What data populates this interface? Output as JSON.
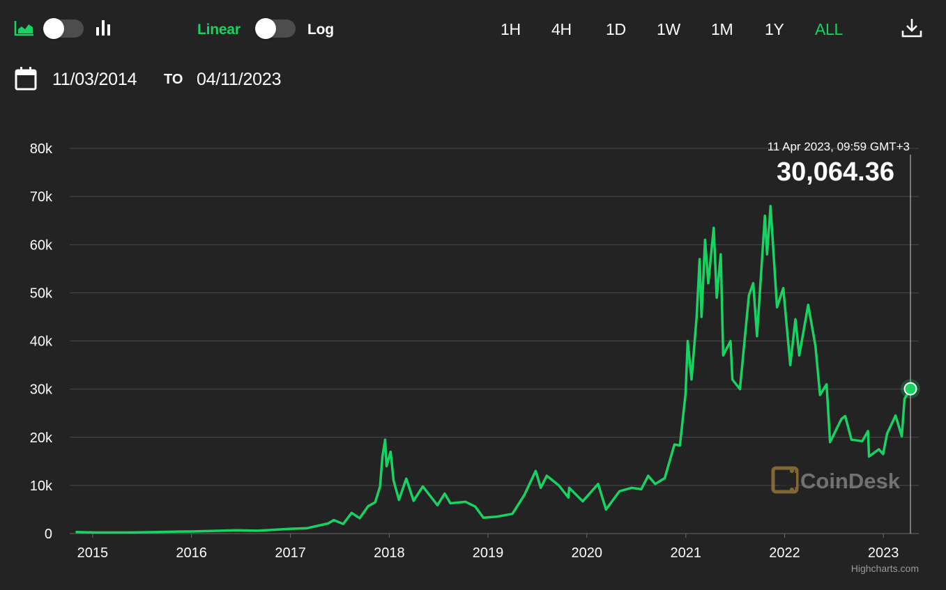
{
  "toolbar": {
    "chart_type_toggle": {
      "left_icon": "area-chart-icon",
      "right_icon": "bar-chart-icon",
      "on": false
    },
    "scale": {
      "linear_label": "Linear",
      "log_label": "Log",
      "log_on": false
    },
    "ranges": [
      "1H",
      "4H",
      "1D",
      "1W",
      "1M",
      "1Y",
      "ALL"
    ],
    "active_range": "ALL",
    "download_icon": "download-icon"
  },
  "date_range": {
    "calendar_icon": "calendar-icon",
    "from": "11/03/2014",
    "to_label": "TO",
    "to": "04/11/2023"
  },
  "tooltip": {
    "date": "11 Apr 2023, 09:59 GMT+3",
    "value": "30,064.36"
  },
  "watermark": "CoinDesk",
  "credits": "Highcharts.com",
  "colors": {
    "accent": "#17d462",
    "background": "#232323",
    "grid": "#4a4a4a",
    "toggle_track": "#4d4d4d"
  },
  "chart_data": {
    "type": "line",
    "x_label": "",
    "y_label": "",
    "y_range": [
      0,
      80000
    ],
    "y_ticks": [
      0,
      10000,
      20000,
      30000,
      40000,
      50000,
      60000,
      70000,
      80000
    ],
    "y_tick_labels": [
      "0",
      "10k",
      "20k",
      "30k",
      "40k",
      "50k",
      "60k",
      "70k",
      "80k"
    ],
    "x_ticks": [
      "2015",
      "2016",
      "2017",
      "2018",
      "2019",
      "2020",
      "2021",
      "2022",
      "2023"
    ],
    "x_range": [
      "2014-11-03",
      "2023-04-11"
    ],
    "grid": true,
    "series": [
      {
        "values_note_free": true,
        "points": [
          [
            "2014-11-03",
            330
          ],
          [
            "2015-01-15",
            210
          ],
          [
            "2015-06-01",
            230
          ],
          [
            "2015-11-05",
            400
          ],
          [
            "2016-01-01",
            430
          ],
          [
            "2016-06-15",
            700
          ],
          [
            "2016-09-01",
            600
          ],
          [
            "2017-01-01",
            1000
          ],
          [
            "2017-03-01",
            1100
          ],
          [
            "2017-05-20",
            2100
          ],
          [
            "2017-06-10",
            2800
          ],
          [
            "2017-07-15",
            2000
          ],
          [
            "2017-08-15",
            4300
          ],
          [
            "2017-09-14",
            3200
          ],
          [
            "2017-10-15",
            5700
          ],
          [
            "2017-11-10",
            6500
          ],
          [
            "2017-11-28",
            9800
          ],
          [
            "2017-12-07",
            16000
          ],
          [
            "2017-12-17",
            19500
          ],
          [
            "2017-12-22",
            14000
          ],
          [
            "2018-01-06",
            17000
          ],
          [
            "2018-01-17",
            11000
          ],
          [
            "2018-02-06",
            7000
          ],
          [
            "2018-03-05",
            11400
          ],
          [
            "2018-04-01",
            6800
          ],
          [
            "2018-05-05",
            9800
          ],
          [
            "2018-06-28",
            5900
          ],
          [
            "2018-07-25",
            8300
          ],
          [
            "2018-08-15",
            6300
          ],
          [
            "2018-10-10",
            6600
          ],
          [
            "2018-11-15",
            5600
          ],
          [
            "2018-12-15",
            3300
          ],
          [
            "2019-02-01",
            3500
          ],
          [
            "2019-04-01",
            4100
          ],
          [
            "2019-05-15",
            8000
          ],
          [
            "2019-06-26",
            13000
          ],
          [
            "2019-07-15",
            9500
          ],
          [
            "2019-08-06",
            12000
          ],
          [
            "2019-09-20",
            10000
          ],
          [
            "2019-10-25",
            7500
          ],
          [
            "2019-10-28",
            9500
          ],
          [
            "2019-12-17",
            6700
          ],
          [
            "2020-02-12",
            10300
          ],
          [
            "2020-03-12",
            5000
          ],
          [
            "2020-05-01",
            8800
          ],
          [
            "2020-06-15",
            9500
          ],
          [
            "2020-07-20",
            9200
          ],
          [
            "2020-08-15",
            12000
          ],
          [
            "2020-09-10",
            10300
          ],
          [
            "2020-10-15",
            11500
          ],
          [
            "2020-11-20",
            18500
          ],
          [
            "2020-12-10",
            18300
          ],
          [
            "2020-12-31",
            29000
          ],
          [
            "2021-01-08",
            40000
          ],
          [
            "2021-01-22",
            32000
          ],
          [
            "2021-02-10",
            45000
          ],
          [
            "2021-02-21",
            57000
          ],
          [
            "2021-02-28",
            45000
          ],
          [
            "2021-03-13",
            61000
          ],
          [
            "2021-03-25",
            52000
          ],
          [
            "2021-04-14",
            63500
          ],
          [
            "2021-04-25",
            49000
          ],
          [
            "2021-05-10",
            58000
          ],
          [
            "2021-05-19",
            37000
          ],
          [
            "2021-06-15",
            40000
          ],
          [
            "2021-06-22",
            32000
          ],
          [
            "2021-07-20",
            30000
          ],
          [
            "2021-08-22",
            49500
          ],
          [
            "2021-09-07",
            52000
          ],
          [
            "2021-09-21",
            41000
          ],
          [
            "2021-10-20",
            66000
          ],
          [
            "2021-10-28",
            58000
          ],
          [
            "2021-11-10",
            68000
          ],
          [
            "2021-12-04",
            47000
          ],
          [
            "2021-12-27",
            51000
          ],
          [
            "2022-01-22",
            35000
          ],
          [
            "2022-02-10",
            44500
          ],
          [
            "2022-02-24",
            37000
          ],
          [
            "2022-03-29",
            47500
          ],
          [
            "2022-04-25",
            39000
          ],
          [
            "2022-05-12",
            28800
          ],
          [
            "2022-06-05",
            31000
          ],
          [
            "2022-06-18",
            19000
          ],
          [
            "2022-07-30",
            23800
          ],
          [
            "2022-08-13",
            24400
          ],
          [
            "2022-09-05",
            19500
          ],
          [
            "2022-10-15",
            19200
          ],
          [
            "2022-11-05",
            21300
          ],
          [
            "2022-11-09",
            16000
          ],
          [
            "2022-12-15",
            17500
          ],
          [
            "2022-12-31",
            16500
          ],
          [
            "2023-01-15",
            20800
          ],
          [
            "2023-02-15",
            24500
          ],
          [
            "2023-03-10",
            20200
          ],
          [
            "2023-03-20",
            28000
          ],
          [
            "2023-04-11",
            30064
          ]
        ]
      }
    ]
  }
}
